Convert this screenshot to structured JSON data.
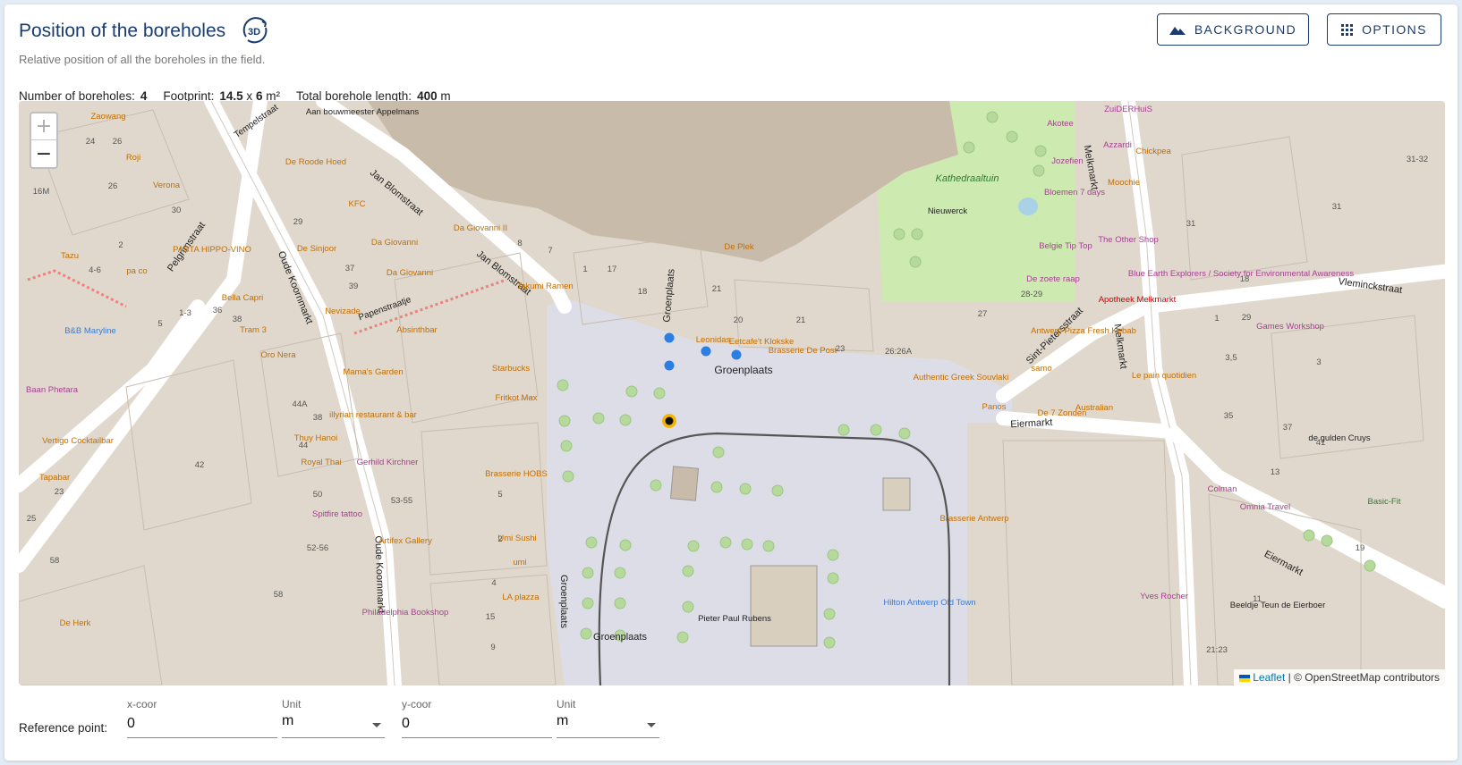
{
  "header": {
    "title": "Position of the boreholes",
    "badge_3d": "3D",
    "subtitle": "Relative position of all the boreholes in the field."
  },
  "buttons": {
    "background": "BACKGROUND",
    "options": "OPTIONS"
  },
  "stats": {
    "count_label": "Number of boreholes:",
    "count_value": "4",
    "footprint_label": "Footprint:",
    "footprint_w": "14.5",
    "footprint_x": "x",
    "footprint_h": "6",
    "footprint_unit": "m²",
    "length_label": "Total borehole length:",
    "length_value": "400",
    "length_unit": "m"
  },
  "map": {
    "zoom_in": "+",
    "zoom_out": "−",
    "attribution_leaflet": "Leaflet",
    "attribution_osm": "| © OpenStreetMap contributors",
    "streets": [
      "Groenplaats",
      "Groenplaats",
      "Groenplaats",
      "Groenplaats",
      "Jan Blomstraat",
      "Jan Blomstraat",
      "Oude Koornmarkt",
      "Oude Koornmarkt",
      "Pelgrimstraat",
      "Papenstraatje",
      "Tempelstraat",
      "Melkmarkt",
      "Melkmarkt",
      "Sint-Pietersstraat",
      "Eiermarkt",
      "Eiermarkt",
      "Vleminckstraat"
    ],
    "places": [
      "Kathedraaltuin",
      "Nieuwerck",
      "De Roode Hoed",
      "KFC",
      "Da Giovanni",
      "Da Giovanni",
      "Da Giovanni II",
      "De Sinjoor",
      "Nevizade",
      "Absinthbar",
      "Starbucks",
      "Fritkot Max",
      "Brasserie HOBS",
      "Umi Sushi",
      "Takumi Ramen",
      "De Plek",
      "Leonidas",
      "Eetcafe't Klokske",
      "Brasserie De Post",
      "Authentic Greek Souvlaki",
      "Panos",
      "De 7 Zonden",
      "Australian",
      "samo",
      "Antwerp Pizza Fresh Kebab",
      "Apotheek Melkmarkt",
      "Le pain quotidien",
      "Pieter Paul Rubens",
      "Hilton Antwerp Old Town",
      "Brasserie Antwerp",
      "Yves Rocher",
      "Beeldje Teun de Eierboer",
      "Colman",
      "Omnia Travel",
      "Blue Earth Explorers / Society for Environmental Awareness",
      "The Other Shop",
      "Games Workshop",
      "Moochie",
      "Azzardi",
      "Chickpea",
      "Akotee",
      "Jozefien",
      "Bloemen 7 days",
      "Belgie Tip Top",
      "De zoete raap",
      "Zaowang",
      "Roji",
      "Verona",
      "Tazu",
      "pa co",
      "PASTA HIPPO-VINO",
      "Bella Capri",
      "Tram 3",
      "Oro Nera",
      "B&B Maryline",
      "Baan Phetara",
      "Vertigo Cocktailbar",
      "Tapabar",
      "Mama's Garden",
      "illyrian restaurant & bar",
      "Thuy Hanoi",
      "Royal Thai",
      "Gerhild Kirchner",
      "Spitfire tattoo",
      "Artifex Gallery",
      "Philadelphia Bookshop",
      "LA plazza",
      "umi",
      "De Herk",
      "Aan bouwmeester Appelmans",
      "de gulden Cruys",
      "Basic-Fit",
      "ZuiDERHuiS"
    ],
    "numbers": [
      "24",
      "26",
      "26",
      "30",
      "2",
      "4-6",
      "16M",
      "29",
      "37",
      "39",
      "36",
      "38",
      "1-3",
      "5",
      "38",
      "44A",
      "44",
      "42",
      "50",
      "53-55",
      "52-56",
      "58",
      "58",
      "25",
      "23",
      "21",
      "1",
      "17",
      "18",
      "20",
      "21",
      "23",
      "26:26A",
      "27",
      "28-29",
      "1",
      "3,5",
      "35",
      "37",
      "41",
      "13",
      "19",
      "11",
      "21:23",
      "31-32",
      "31",
      "31",
      "18",
      "29",
      "3",
      "5",
      "2",
      "4",
      "15",
      "9",
      "8",
      "7",
      "6",
      "5",
      "7",
      "16"
    ]
  },
  "reference": {
    "label": "Reference point:",
    "x_label": "x-coor",
    "x_value": "0",
    "x_unit_label": "Unit",
    "x_unit": "m",
    "y_label": "y-coor",
    "y_value": "0",
    "y_unit_label": "Unit",
    "y_unit": "m"
  }
}
